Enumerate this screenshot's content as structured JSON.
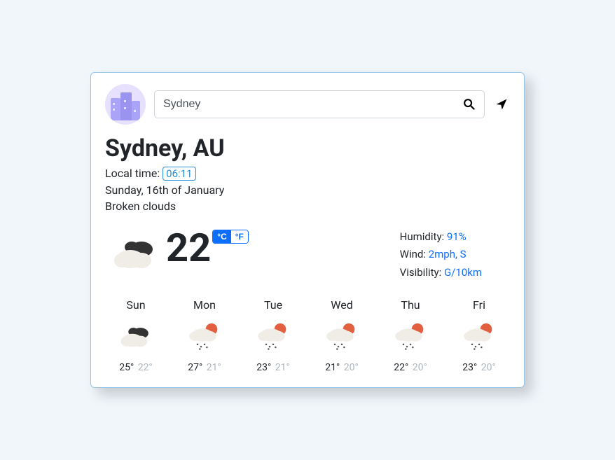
{
  "search": {
    "value": "Sydney"
  },
  "location_title": "Sydney, AU",
  "local_time_label": "Local time: ",
  "local_time": "06:11",
  "date_line": "Sunday, 16th of January",
  "condition": "Broken clouds",
  "current_temp": "22",
  "unit_c": "°C",
  "unit_f": "°F",
  "details": {
    "humidity_label": "Humidity: ",
    "humidity_value": "91%",
    "wind_label": "Wind: ",
    "wind_value": "2mph, S",
    "visibility_label": "Visibility: ",
    "visibility_value": "G/10km"
  },
  "forecast": [
    {
      "day": "Sun",
      "icon": "cloud-dark",
      "hi": "25°",
      "lo": "22°"
    },
    {
      "day": "Mon",
      "icon": "rain-sun",
      "hi": "27°",
      "lo": "21°"
    },
    {
      "day": "Tue",
      "icon": "rain-sun",
      "hi": "23°",
      "lo": "21°"
    },
    {
      "day": "Wed",
      "icon": "rain-sun",
      "hi": "21°",
      "lo": "20°"
    },
    {
      "day": "Thu",
      "icon": "rain-sun",
      "hi": "22°",
      "lo": "20°"
    },
    {
      "day": "Fri",
      "icon": "rain-sun",
      "hi": "23°",
      "lo": "20°"
    }
  ]
}
